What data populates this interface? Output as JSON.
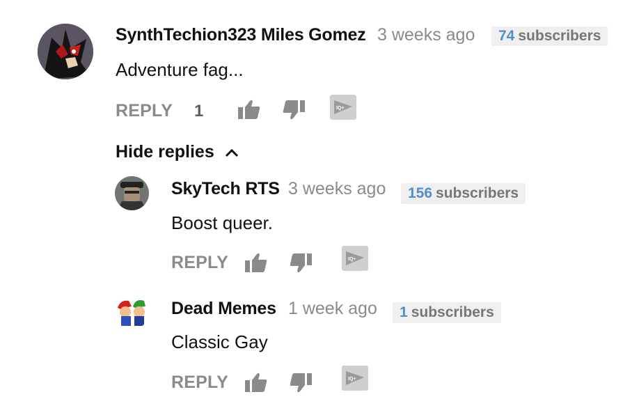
{
  "comment": {
    "author": "SynthTechion323 Miles Gomez",
    "time": "3 weeks ago",
    "subs_count": "74",
    "subs_label": "subscribers",
    "text": "Adventure fag...",
    "reply_label": "REPLY",
    "like_count": "1"
  },
  "hide_replies_label": "Hide replies",
  "replies": [
    {
      "author": "SkyTech RTS",
      "time": "3 weeks ago",
      "subs_count": "156",
      "subs_label": "subscribers",
      "text": "Boost queer.",
      "reply_label": "REPLY"
    },
    {
      "author": "Dead Memes",
      "time": "1 week ago",
      "subs_count": "1",
      "subs_label": "subscribers",
      "text": "Classic Gay",
      "reply_label": "REPLY"
    }
  ],
  "colors": {
    "subs_number": "#4f8fd0",
    "muted": "#8a8a8a",
    "badge_bg": "#efefef"
  },
  "icons": [
    "thumbs-up-icon",
    "thumbs-down-icon",
    "play-flag-icon",
    "chevron-up-icon"
  ]
}
